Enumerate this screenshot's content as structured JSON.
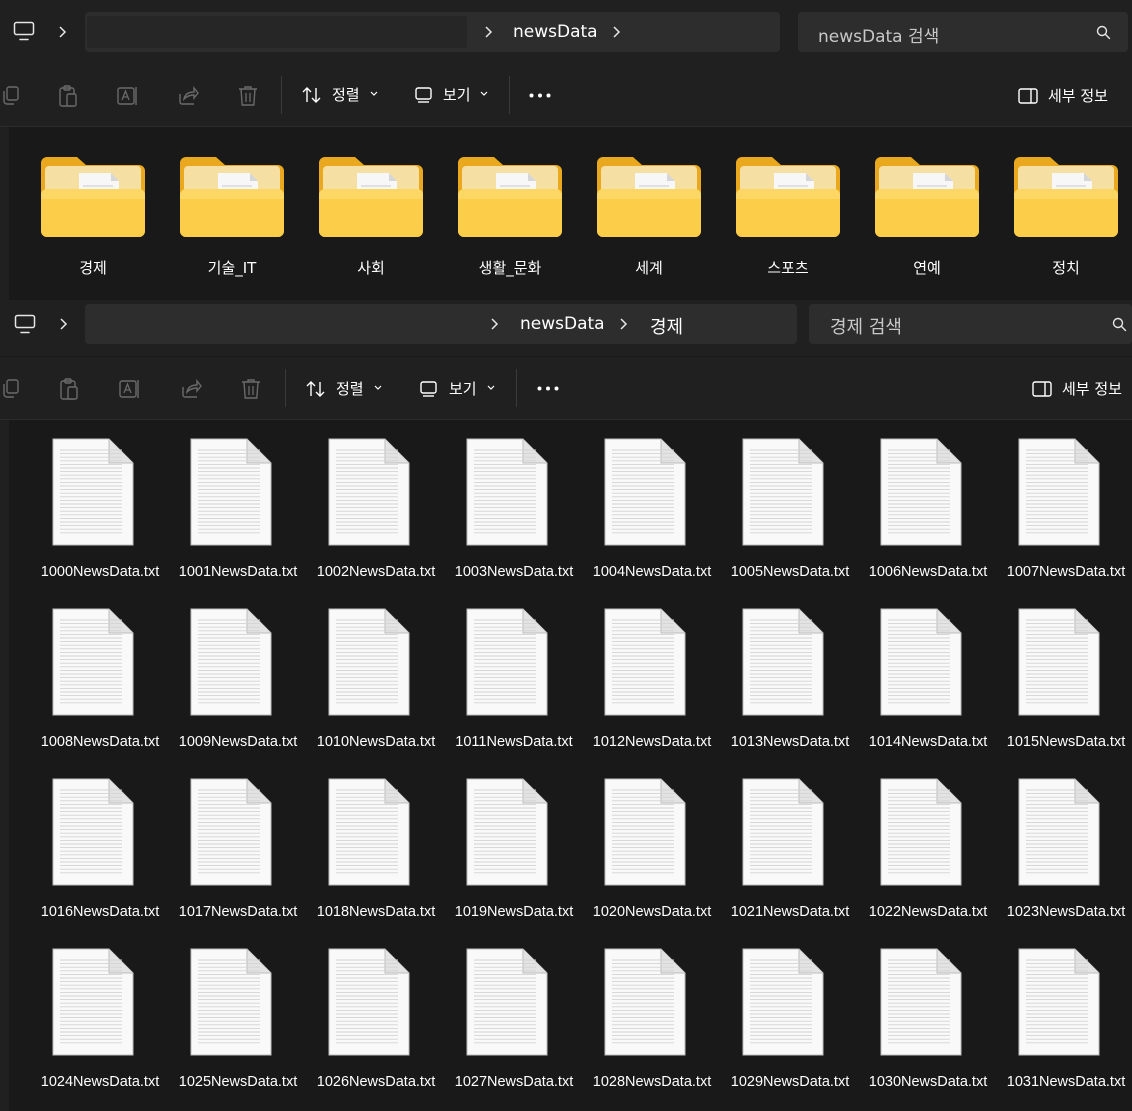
{
  "window1": {
    "breadcrumb": {
      "folder": "newsData"
    },
    "search": {
      "placeholder": "newsData 검색"
    },
    "toolbar": {
      "sort_label": "정렬",
      "view_label": "보기",
      "details_label": "세부 정보"
    },
    "folders": [
      {
        "label": "경제"
      },
      {
        "label": "기술_IT"
      },
      {
        "label": "사회"
      },
      {
        "label": "생활_문화"
      },
      {
        "label": "세계"
      },
      {
        "label": "스포츠"
      },
      {
        "label": "연예"
      },
      {
        "label": "정치"
      }
    ]
  },
  "window2": {
    "breadcrumb": {
      "parent": "newsData",
      "current": "경제"
    },
    "search": {
      "placeholder": "경제 검색"
    },
    "toolbar": {
      "sort_label": "정렬",
      "view_label": "보기",
      "details_label": "세부 정보"
    },
    "files": [
      "1000NewsData.txt",
      "1001NewsData.txt",
      "1002NewsData.txt",
      "1003NewsData.txt",
      "1004NewsData.txt",
      "1005NewsData.txt",
      "1006NewsData.txt",
      "1007NewsData.txt",
      "1008NewsData.txt",
      "1009NewsData.txt",
      "1010NewsData.txt",
      "1011NewsData.txt",
      "1012NewsData.txt",
      "1013NewsData.txt",
      "1014NewsData.txt",
      "1015NewsData.txt",
      "1016NewsData.txt",
      "1017NewsData.txt",
      "1018NewsData.txt",
      "1019NewsData.txt",
      "1020NewsData.txt",
      "1021NewsData.txt",
      "1022NewsData.txt",
      "1023NewsData.txt",
      "1024NewsData.txt",
      "1025NewsData.txt",
      "1026NewsData.txt",
      "1027NewsData.txt",
      "1028NewsData.txt",
      "1029NewsData.txt",
      "1030NewsData.txt",
      "1031NewsData.txt"
    ]
  },
  "icons": {
    "computer": "computer-icon",
    "chevron": "chevron-right-icon",
    "search": "search-icon",
    "copy": "copy-icon",
    "paste": "paste-icon",
    "rename": "rename-icon",
    "share": "share-icon",
    "delete": "delete-icon",
    "sort": "sort-icon",
    "view": "view-icon",
    "more": "more-icon",
    "details": "details-pane-icon",
    "folder": "folder-icon",
    "file": "text-file-icon"
  },
  "colors": {
    "background": "#191919",
    "chrome": "#202020",
    "field": "#2d2d2d",
    "folder": "#f8c640"
  }
}
